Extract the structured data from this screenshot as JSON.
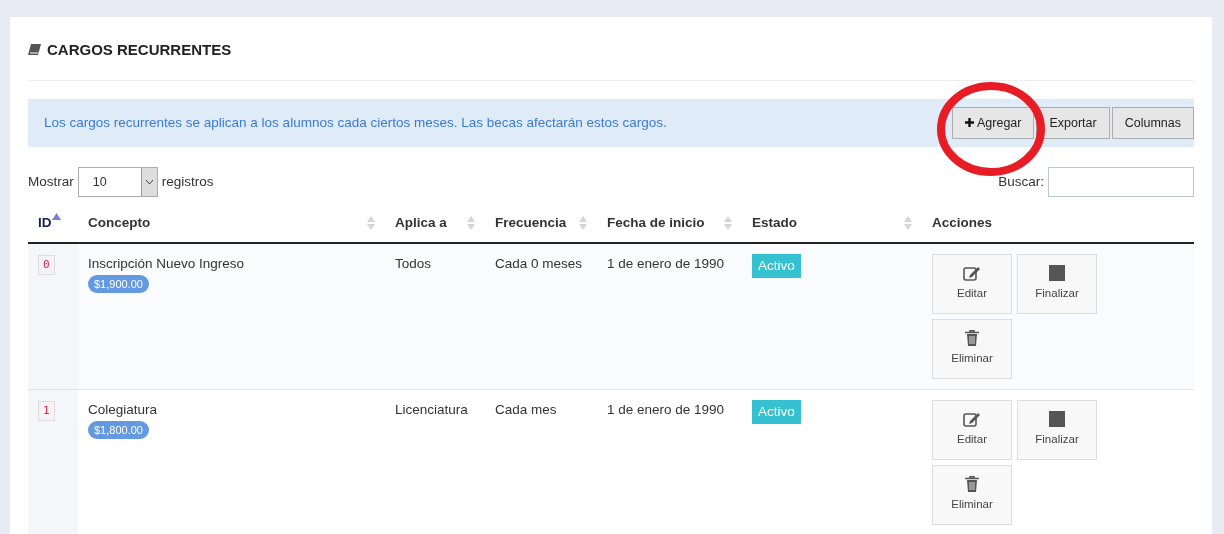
{
  "title": "CARGOS RECURRENTES",
  "info": "Los cargos recurrentes se aplican a los alumnos cada ciertos meses. Las becas afectarán estos cargos.",
  "toolbar": [
    {
      "label": "Agregar",
      "kind": "add",
      "highlighted": true
    },
    {
      "label": "Exportar",
      "kind": "plain",
      "highlighted": false
    },
    {
      "label": "Columnas",
      "kind": "plain",
      "highlighted": false
    }
  ],
  "length": {
    "before": "Mostrar",
    "value": "10",
    "after": "registros"
  },
  "search": {
    "label": "Buscar:"
  },
  "table": {
    "columns": [
      {
        "label": "ID",
        "sortable": true,
        "sorted": true
      },
      {
        "label": "Concepto",
        "sortable": true,
        "sorted": false
      },
      {
        "label": "Aplica a",
        "sortable": true,
        "sorted": false
      },
      {
        "label": "Frecuencia",
        "sortable": true,
        "sorted": false
      },
      {
        "label": "Fecha de inicio",
        "sortable": true,
        "sorted": false
      },
      {
        "label": "Estado",
        "sortable": true,
        "sorted": false
      },
      {
        "label": "Acciones",
        "sortable": false,
        "sorted": false
      }
    ],
    "rows": [
      {
        "id": "0",
        "concept": "Inscripción Nuevo Ingreso",
        "amount": "$1,900.00",
        "applies": "Todos",
        "frequency": "Cada 0 meses",
        "start": "1 de enero de 1990",
        "status": "Activo",
        "actions": [
          {
            "label": "Editar",
            "kind": "edit"
          },
          {
            "label": "Finalizar",
            "kind": "stop"
          },
          {
            "label": "Eliminar",
            "kind": "delete"
          }
        ]
      },
      {
        "id": "1",
        "concept": "Colegiatura",
        "amount": "$1,800.00",
        "applies": "Licenciatura",
        "frequency": "Cada mes",
        "start": "1 de enero de 1990",
        "status": "Activo",
        "actions": [
          {
            "label": "Editar",
            "kind": "edit"
          },
          {
            "label": "Finalizar",
            "kind": "stop"
          },
          {
            "label": "Eliminar",
            "kind": "delete"
          }
        ]
      }
    ]
  }
}
